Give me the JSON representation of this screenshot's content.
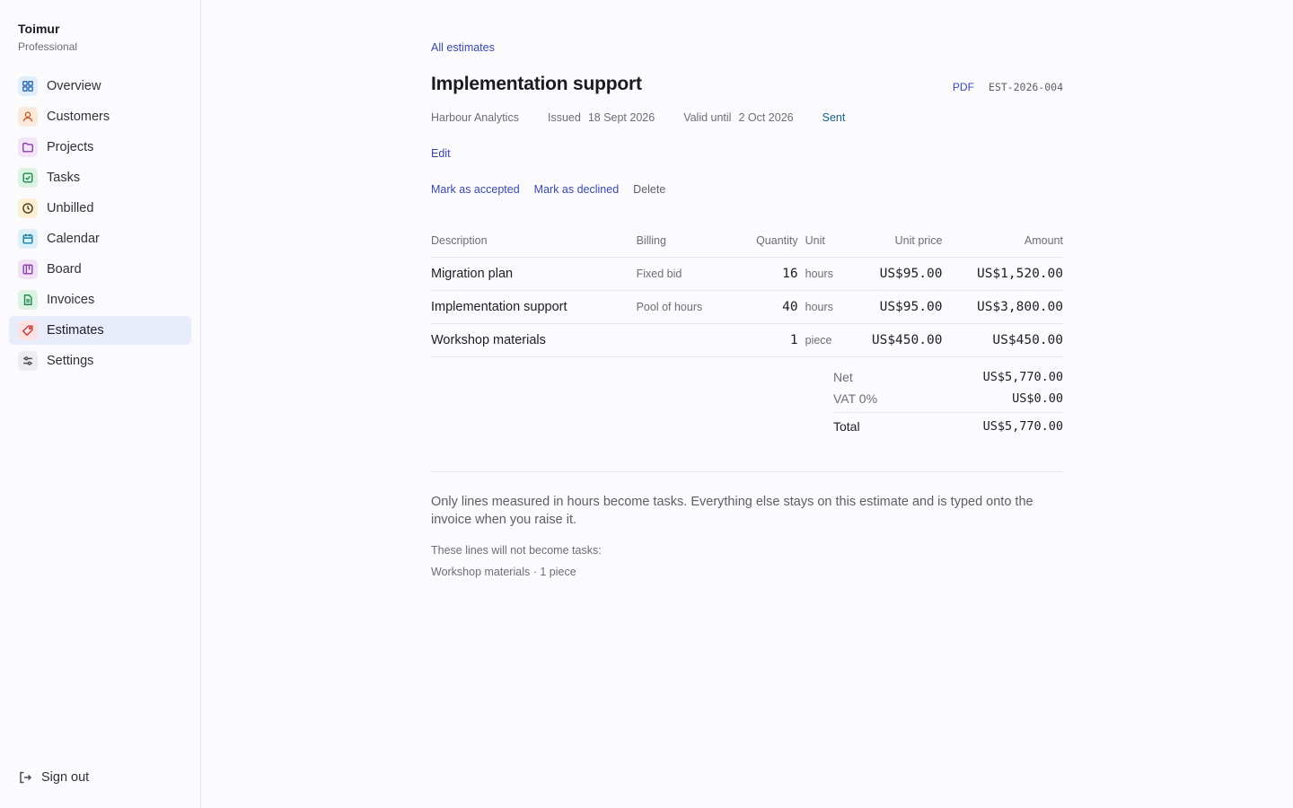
{
  "sidebar": {
    "brand_name": "Toimur",
    "brand_plan": "Professional",
    "items": [
      {
        "label": "Overview",
        "icon": "grid-icon",
        "color": "#2f6fb3",
        "bg": "#e3eefb"
      },
      {
        "label": "Customers",
        "icon": "user-icon",
        "color": "#c2612a",
        "bg": "#fce9dc"
      },
      {
        "label": "Projects",
        "icon": "folder-icon",
        "color": "#8a3fa6",
        "bg": "#f3e4f7"
      },
      {
        "label": "Tasks",
        "icon": "check-square-icon",
        "color": "#1f8a4c",
        "bg": "#dcf3e4"
      },
      {
        "label": "Unbilled",
        "icon": "clock-icon",
        "color": "#9a6a12",
        "bg": "#fbefd4"
      },
      {
        "label": "Calendar",
        "icon": "calendar-icon",
        "color": "#1b7fa3",
        "bg": "#dcf0f7"
      },
      {
        "label": "Board",
        "icon": "board-icon",
        "color": "#8a3fa6",
        "bg": "#f1e3f6"
      },
      {
        "label": "Invoices",
        "icon": "file-icon",
        "color": "#1f8a4c",
        "bg": "#dcf3e4"
      },
      {
        "label": "Estimates",
        "icon": "tag-icon",
        "color": "#c23a3a",
        "bg": "#fbe1e1"
      },
      {
        "label": "Settings",
        "icon": "sliders-icon",
        "color": "#4a4a56",
        "bg": "#ececf1"
      }
    ],
    "active": "Estimates",
    "sign_out": "Sign out"
  },
  "estimate": {
    "back_link": "All estimates",
    "title": "Implementation support",
    "pdf_label": "PDF",
    "number": "EST-2026-004",
    "customer": "Harbour Analytics",
    "issued_label": "Issued",
    "issued_value": "18 Sept 2026",
    "valid_label": "Valid until",
    "valid_value": "2 Oct 2026",
    "status": "Sent",
    "edit_label": "Edit",
    "accept_label": "Mark as accepted",
    "decline_label": "Mark as declined",
    "delete_label": "Delete"
  },
  "table": {
    "headers": {
      "description": "Description",
      "billing": "Billing",
      "quantity": "Quantity",
      "unit": "Unit",
      "unit_price": "Unit price",
      "amount": "Amount"
    },
    "rows": [
      {
        "description": "Migration plan",
        "billing": "Fixed bid",
        "quantity": "16",
        "unit": "hours",
        "unit_price": "US$95.00",
        "amount": "US$1,520.00"
      },
      {
        "description": "Implementation support",
        "billing": "Pool of hours",
        "quantity": "40",
        "unit": "hours",
        "unit_price": "US$95.00",
        "amount": "US$3,800.00"
      },
      {
        "description": "Workshop materials",
        "billing": "",
        "quantity": "1",
        "unit": "piece",
        "unit_price": "US$450.00",
        "amount": "US$450.00"
      }
    ]
  },
  "totals": {
    "net_label": "Net",
    "net_value": "US$5,770.00",
    "vat_label": "VAT 0%",
    "vat_value": "US$0.00",
    "total_label": "Total",
    "total_value": "US$5,770.00"
  },
  "notes": {
    "explanation": "Only lines measured in hours become tasks. Everything else stays on this estimate and is typed onto the invoice when you raise it.",
    "not_tasks_label": "These lines will not become tasks:",
    "not_tasks_item": "Workshop materials · 1 piece"
  }
}
